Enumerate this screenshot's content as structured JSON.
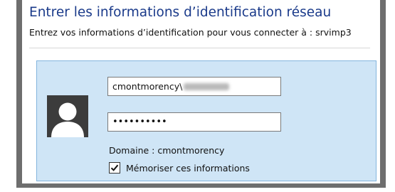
{
  "dialog": {
    "title": "Entrer les informations d’identification réseau",
    "subtitle": "Entrez vos informations d’identification pour vous connecter à : srvimp3"
  },
  "credentials": {
    "avatar_icon": "user-avatar-icon",
    "username_value": "cmontmorency\\",
    "password_value": "••••••••••",
    "domain_text": "Domaine : cmontmorency",
    "remember_label": "Mémoriser ces informations",
    "remember_checked": true
  },
  "colors": {
    "title": "#1a3a8a",
    "tile_background": "#cfe5f6",
    "tile_border": "#84b5de"
  }
}
